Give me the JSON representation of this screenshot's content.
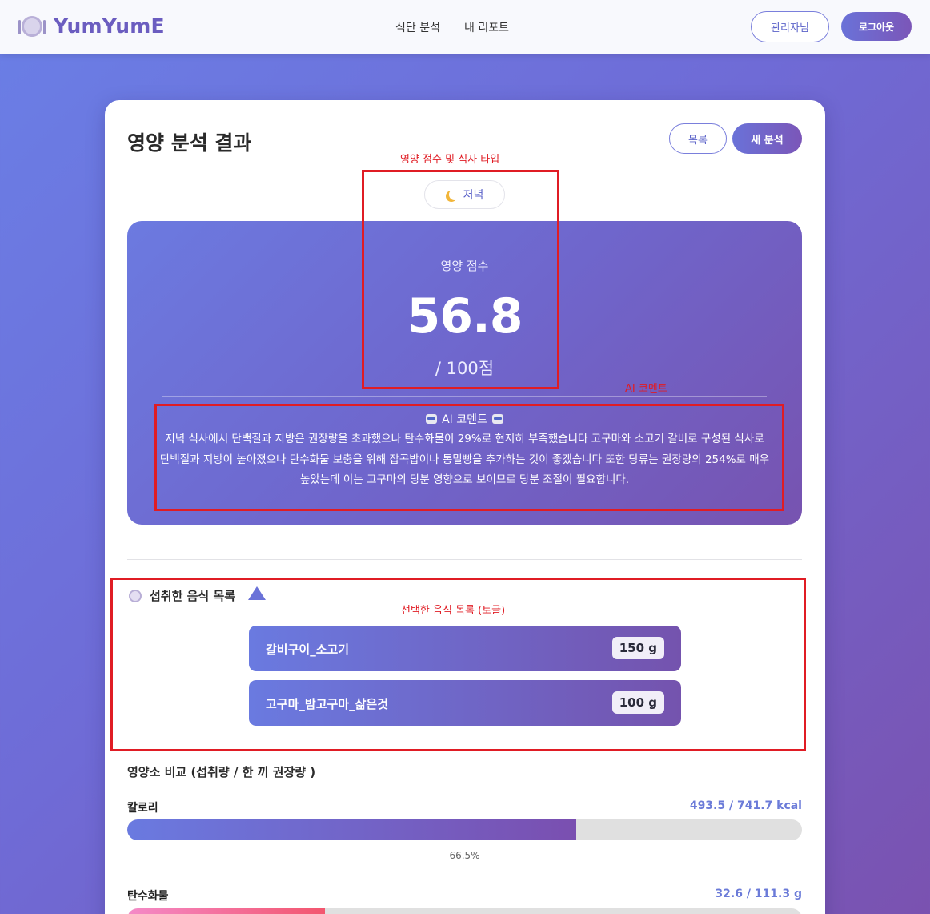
{
  "nav": {
    "logo_text": "YumYumE",
    "links": [
      "식단 분석",
      "내 리포트"
    ],
    "admin_label": "관리자님",
    "logout_label": "로그아웃"
  },
  "page": {
    "title": "영양 분석 결과",
    "list_button": "목록",
    "new_button": "새 분석",
    "meal_type": "저녁"
  },
  "score": {
    "label": "영양 점수",
    "value": "56.8",
    "max_text": "/ 100점"
  },
  "ai_comment": {
    "title": "AI 코멘트",
    "text": "저녁 식사에서 단백질과 지방은 권장량을 초과했으나 탄수화물이 29%로 현저히 부족했습니다 고구마와 소고기 갈비로 구성된 식사로 단백질과 지방이 높아졌으나 탄수화물 보충을 위해 잡곡밥이나 통밀빵을 추가하는 것이 좋겠습니다 또한 당류는 권장량의 254%로 매우 높았는데 이는 고구마의 당분 영향으로 보이므로 당분 조절이 필요합니다."
  },
  "annotations": {
    "score_label": "영양 점수 및 식사 타입",
    "ai_label": "AI 코멘트",
    "foods_label": "선택한 음식 목록 (토글)"
  },
  "foods": {
    "header": "섭취한 음식 목록",
    "items": [
      {
        "name": "갈비구이_소고기",
        "qty": "150 g"
      },
      {
        "name": "고구마_밤고구마_삶은것",
        "qty": "100 g"
      }
    ]
  },
  "comparison": {
    "title": "영양소 비교 (섭취량 / 한 끼 권장량 )",
    "nutrients": [
      {
        "label": "칼로리",
        "value_text": "493.5 / 741.7 kcal",
        "fraction": 0.665,
        "pct_text": "66.5%"
      },
      {
        "label": "탄수화물",
        "value_text": "32.6 / 111.3 g",
        "fraction": 0.293
      }
    ]
  },
  "colors": {
    "accent": "#6a72d8",
    "annotation": "#e01c24",
    "brand_purple": "#6b5dc0"
  }
}
